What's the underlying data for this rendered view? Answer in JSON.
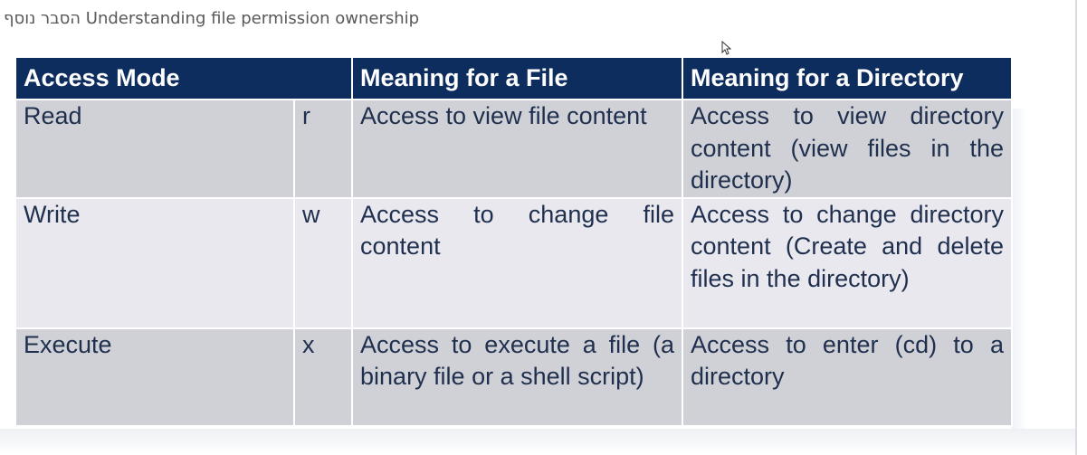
{
  "header": {
    "title": "הסבר נוסף Understanding file permission ownership"
  },
  "table": {
    "headers": {
      "access_mode": "Access Mode",
      "file": "Meaning for a File",
      "directory": "Meaning for a Directory"
    },
    "rows": [
      {
        "mode": "Read",
        "letter": "r",
        "file": "Access to view file content",
        "directory": "Access to view directory content (view files in the directory)"
      },
      {
        "mode": "Write",
        "letter": "w",
        "file": "Access to change file content",
        "directory": "Access to change directory content (Create and delete files in the directory)"
      },
      {
        "mode": "Execute",
        "letter": "x",
        "file": "Access to execute a file (a binary file or a shell script)",
        "directory": "Access to enter (cd) to a directory"
      }
    ]
  },
  "icons": {
    "cursor": "mouse-pointer-icon"
  },
  "colors": {
    "header_bg": "#0d2d5e",
    "row_bg": "#d0d1d6",
    "row_alt_bg": "#e9e8ee",
    "text": "#1f2f4e"
  }
}
